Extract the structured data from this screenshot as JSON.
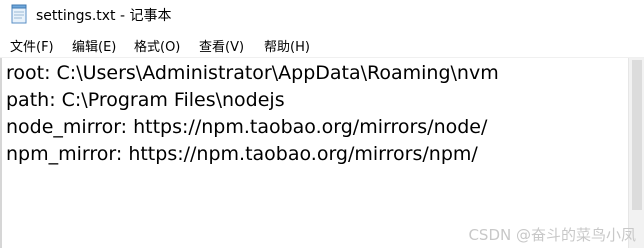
{
  "window": {
    "title": "settings.txt - 记事本"
  },
  "menu": {
    "items": [
      {
        "label": "文件(F)"
      },
      {
        "label": "编辑(E)"
      },
      {
        "label": "格式(O)"
      },
      {
        "label": "查看(V)"
      },
      {
        "label": "帮助(H)"
      }
    ]
  },
  "document": {
    "lines": [
      "root: C:\\Users\\Administrator\\AppData\\Roaming\\nvm",
      "path: C:\\Program Files\\nodejs",
      "node_mirror: https://npm.taobao.org/mirrors/node/",
      "npm_mirror: https://npm.taobao.org/mirrors/npm/"
    ]
  },
  "watermark": {
    "text": "CSDN @奋斗的菜鸟小凤"
  },
  "icons": {
    "app": "notepad-icon"
  },
  "colors": {
    "background": "#ffffff",
    "text": "#000000",
    "watermark": "#c8c8c8"
  }
}
